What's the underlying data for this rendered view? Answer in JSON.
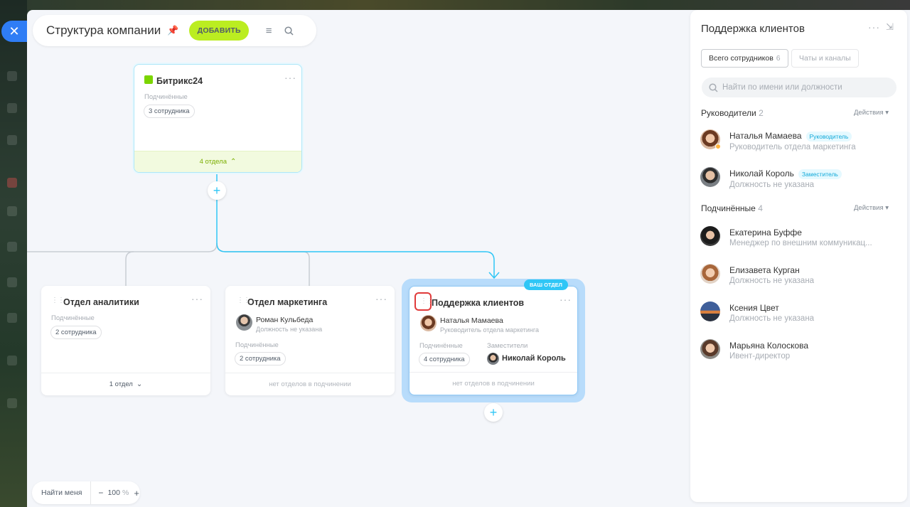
{
  "header": {
    "title": "Структура компании",
    "add_label": "ДОБАВИТЬ"
  },
  "root_card": {
    "title": "Битрикс24",
    "subordinates_label": "Подчинённые",
    "subordinates_count": "3 сотрудника",
    "footer": "4 отдела"
  },
  "departments": [
    {
      "title": "Отдел аналитики",
      "subordinates_label": "Подчинённые",
      "subordinates_count": "2 сотрудника",
      "footer": "1 отдел"
    },
    {
      "title": "Отдел маркетинга",
      "head_name": "Роман Кульбеда",
      "head_position": "Должность не указана",
      "subordinates_label": "Подчинённые",
      "subordinates_count": "2 сотрудника",
      "footer": "нет отделов в подчинении"
    },
    {
      "title": "Поддержка клиентов",
      "badge": "ВАШ ОТДЕЛ",
      "head_name": "Наталья Мамаева",
      "head_position": "Руководитель отдела маркетинга",
      "subordinates_label": "Подчинённые",
      "subordinates_count": "4 сотрудника",
      "deputies_label": "Заместители",
      "deputy_name": "Николай Король",
      "footer": "нет отделов в подчинении"
    }
  ],
  "zoom": {
    "find_me": "Найти меня",
    "minus": "−",
    "level": "100",
    "unit": "%",
    "plus": "+"
  },
  "panel": {
    "title": "Поддержка клиентов",
    "tab_employees": "Всего сотрудников",
    "tab_employees_count": "6",
    "tab_chats": "Чаты и каналы",
    "search_placeholder": "Найти по имени или должности",
    "managers_label": "Руководители",
    "managers_count": "2",
    "subordinates_label": "Подчинённые",
    "subordinates_count": "4",
    "actions_label": "Действия",
    "managers": [
      {
        "name": "Наталья Мамаева",
        "badge": "Руководитель",
        "position": "Руководитель отдела маркетинга"
      },
      {
        "name": "Николай Король",
        "badge": "Заместитель",
        "position": "Должность не указана"
      }
    ],
    "employees": [
      {
        "name": "Екатерина Буффе",
        "position": "Менеджер по внешним коммуникац..."
      },
      {
        "name": "Елизавета Курган",
        "position": "Должность не указана"
      },
      {
        "name": "Ксения Цвет",
        "position": "Должность не указана"
      },
      {
        "name": "Марьяна Колоскова",
        "position": "Ивент-директор"
      }
    ]
  },
  "colors": {
    "accent": "#2fc6f6",
    "add_button": "#bbed21",
    "close_button": "#2f7df5",
    "root_card_border": "#aee6f8",
    "root_card_footer": "#f2fadf",
    "selected_glow": "#b8dcfb",
    "highlight_red": "#e03a3a"
  },
  "icons": [
    "close-icon",
    "pin-icon",
    "menu-icon",
    "search-icon",
    "building-icon",
    "more-icon",
    "drag-handle-icon",
    "plus-icon",
    "collapse-panel-icon",
    "chevron-up-icon",
    "chevron-down-icon"
  ]
}
